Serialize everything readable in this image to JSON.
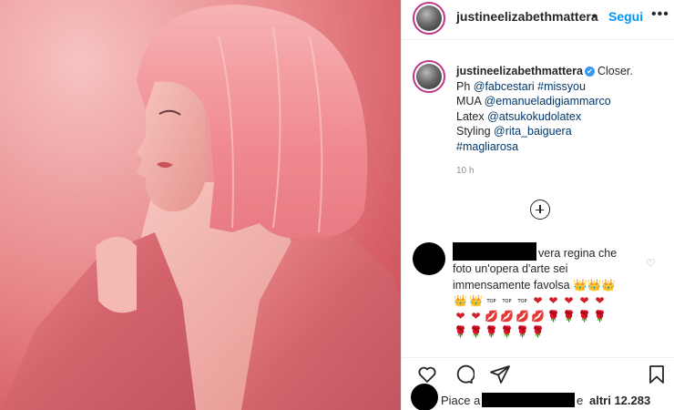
{
  "post": {
    "image_alt": "Woman with pink bob wig in latex outfit",
    "header": {
      "username": "justineelizabethmattera",
      "separator": "•",
      "follow_label": "Segui",
      "more_label": "•••"
    },
    "caption": {
      "username": "justineelizabethmattera",
      "verified_mark": "✔",
      "line1_text": "Closer.",
      "line2_prefix": "Ph ",
      "line2_link1": "@fabcestari",
      "line2_link2": "#missyou",
      "line3_prefix": "MUA ",
      "line3_link": "@emanueladigiammarco",
      "line4_prefix": "Latex ",
      "line4_link": "@atsukokudolatex",
      "line5_prefix": "Styling ",
      "line5_link": "@rita_baiguera",
      "line6_link": "#magliarosa",
      "timestamp": "10 h"
    },
    "comment": {
      "text_part1": "vera regina che",
      "text_part2": "foto un'opera d'arte sei",
      "text_part3": "immensamente favolsa",
      "like_icon": "♡",
      "row1_emojis": [
        "👑",
        "👑",
        "👑"
      ],
      "row2_emojis": [
        "👑",
        "👑",
        "TOP",
        "TOP",
        "TOP",
        "❤",
        "❤",
        "❤",
        "❤",
        "❤"
      ],
      "row3_emojis": [
        "❤",
        "❤",
        "💋",
        "💋",
        "💋",
        "💋",
        "🌹",
        "🌹",
        "🌹",
        "🌹"
      ],
      "row4_emojis": [
        "🌹",
        "🌹",
        "🌹",
        "🌹",
        "🌹",
        "🌹"
      ]
    },
    "likes": {
      "prefix": "Piace a",
      "conjunction": "e",
      "others": "altri 12.283"
    },
    "icons": [
      "heart-icon",
      "comment-icon",
      "share-icon",
      "bookmark-icon",
      "add-comment-icon"
    ],
    "colors": {
      "link": "#00376b",
      "follow": "#0095f6",
      "verified": "#3897f0",
      "wig": "#f08a90"
    }
  }
}
